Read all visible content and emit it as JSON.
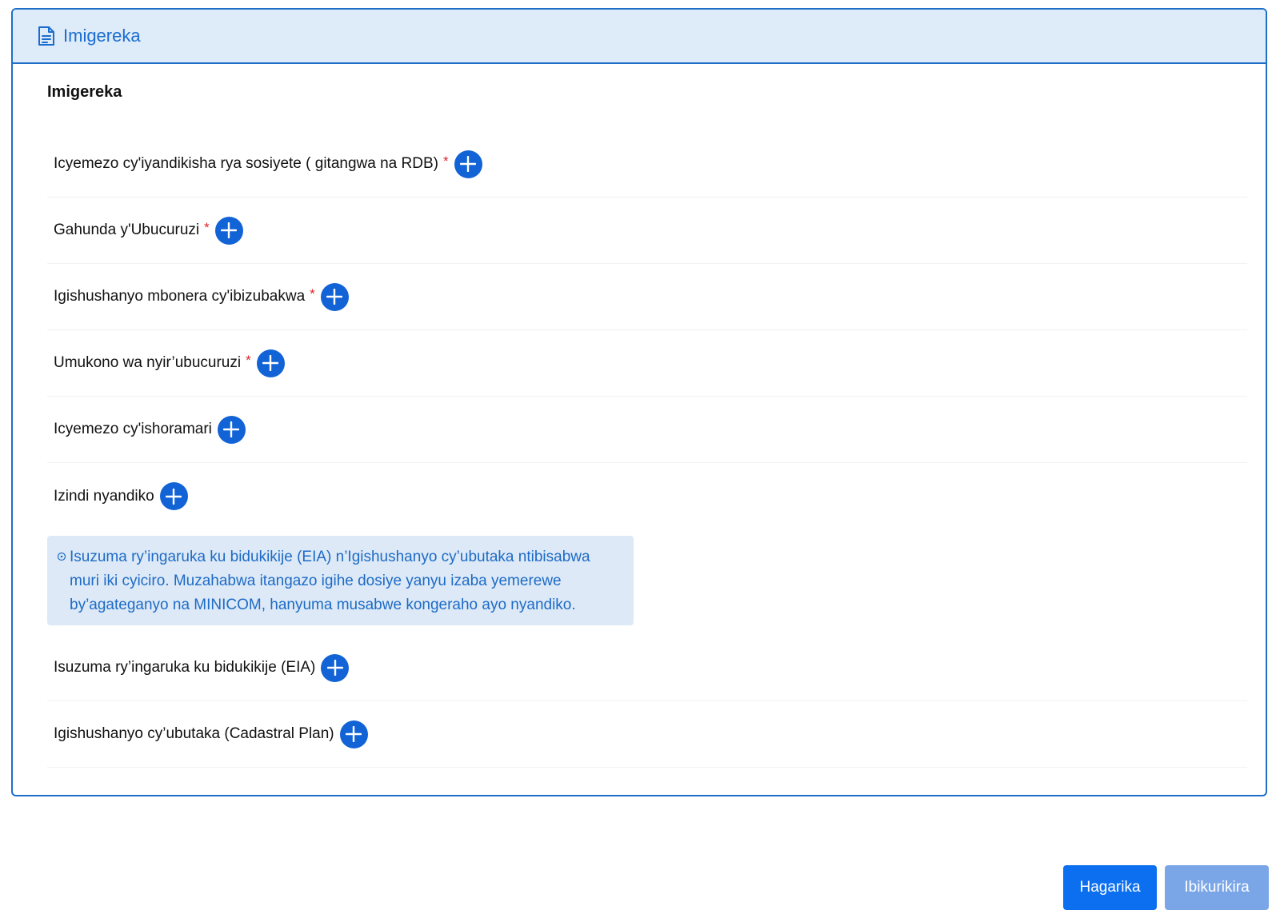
{
  "panel": {
    "header_title": "Imigereka",
    "section_title": "Imigereka",
    "header_icon": "document-icon",
    "accent_color": "#1f6fc9"
  },
  "documents": [
    {
      "label": "Icyemezo cy'iyandikisha rya sosiyete ( gitangwa na RDB)",
      "required_mark": "*"
    },
    {
      "label": "Gahunda y'Ubucuruzi",
      "required_mark": "*"
    },
    {
      "label": "Igishushanyo mbonera cy'ibizubakwa",
      "required_mark": "*"
    },
    {
      "label": "Umukono wa nyir’ubucuruzi",
      "required_mark": "*"
    },
    {
      "label": "Icyemezo cy'ishoramari"
    },
    {
      "label": "Izindi nyandiko"
    }
  ],
  "info_notice": {
    "icon": "info-circle-icon",
    "text": "Isuzuma ry’ingaruka ku bidukikije (EIA) n’Igishushanyo cy’ubutaka ntibisabwa muri iki cyiciro. Muzahabwa itangazo igihe dosiye yanyu izaba yemerewe by’agateganyo na MINICOM, hanyuma musabwe kongeraho ayo nyandiko."
  },
  "deferred_documents": [
    {
      "label": "Isuzuma ry’ingaruka ku bidukikije (EIA)"
    },
    {
      "label": "Igishushanyo cy’ubutaka (Cadastral Plan)"
    }
  ],
  "actions": {
    "cancel_label": "Hagarika",
    "next_label": "Ibikurikira"
  }
}
